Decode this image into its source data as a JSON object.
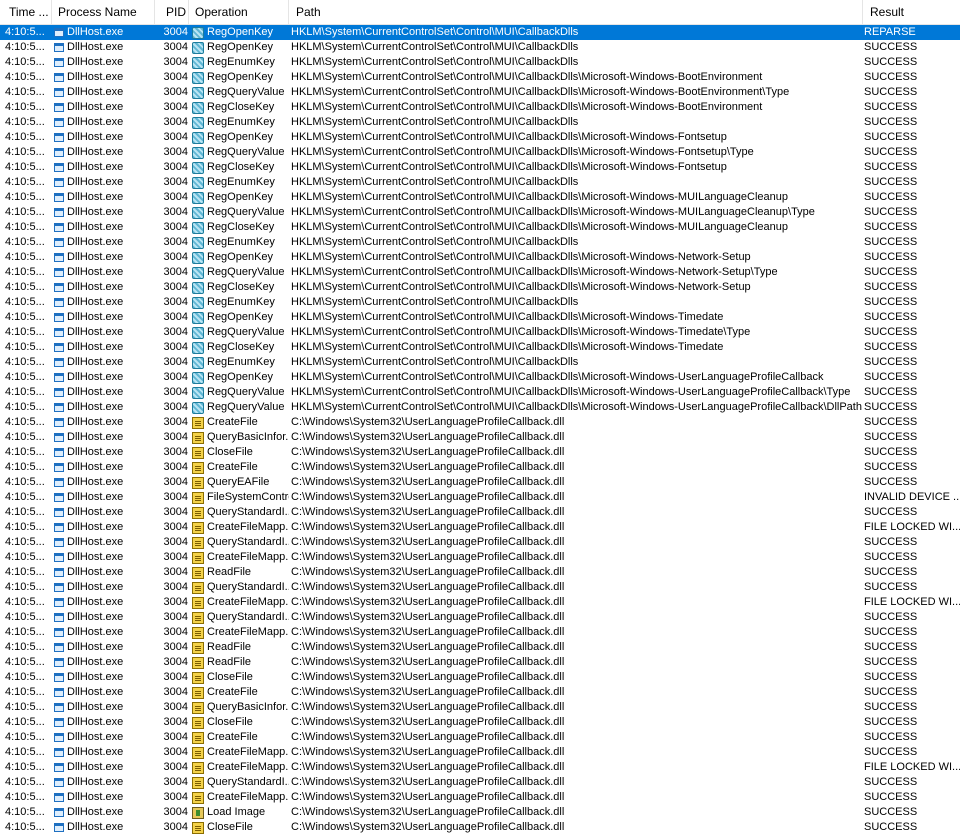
{
  "columns": {
    "time": "Time ...",
    "process": "Process Name",
    "pid": "PID",
    "operation": "Operation",
    "path": "Path",
    "result": "Result"
  },
  "rows": [
    {
      "time": "4:10:5...",
      "process": "DllHost.exe",
      "pid": "3004",
      "operation": "RegOpenKey",
      "icon": "registry-icon",
      "path": "HKLM\\System\\CurrentControlSet\\Control\\MUI\\CallbackDlls",
      "result": "REPARSE",
      "selected": true
    },
    {
      "time": "4:10:5...",
      "process": "DllHost.exe",
      "pid": "3004",
      "operation": "RegOpenKey",
      "icon": "registry-icon",
      "path": "HKLM\\System\\CurrentControlSet\\Control\\MUI\\CallbackDlls",
      "result": "SUCCESS"
    },
    {
      "time": "4:10:5...",
      "process": "DllHost.exe",
      "pid": "3004",
      "operation": "RegEnumKey",
      "icon": "registry-icon",
      "path": "HKLM\\System\\CurrentControlSet\\Control\\MUI\\CallbackDlls",
      "result": "SUCCESS"
    },
    {
      "time": "4:10:5...",
      "process": "DllHost.exe",
      "pid": "3004",
      "operation": "RegOpenKey",
      "icon": "registry-icon",
      "path": "HKLM\\System\\CurrentControlSet\\Control\\MUI\\CallbackDlls\\Microsoft-Windows-BootEnvironment",
      "result": "SUCCESS"
    },
    {
      "time": "4:10:5...",
      "process": "DllHost.exe",
      "pid": "3004",
      "operation": "RegQueryValue",
      "icon": "registry-icon",
      "path": "HKLM\\System\\CurrentControlSet\\Control\\MUI\\CallbackDlls\\Microsoft-Windows-BootEnvironment\\Type",
      "result": "SUCCESS"
    },
    {
      "time": "4:10:5...",
      "process": "DllHost.exe",
      "pid": "3004",
      "operation": "RegCloseKey",
      "icon": "registry-icon",
      "path": "HKLM\\System\\CurrentControlSet\\Control\\MUI\\CallbackDlls\\Microsoft-Windows-BootEnvironment",
      "result": "SUCCESS"
    },
    {
      "time": "4:10:5...",
      "process": "DllHost.exe",
      "pid": "3004",
      "operation": "RegEnumKey",
      "icon": "registry-icon",
      "path": "HKLM\\System\\CurrentControlSet\\Control\\MUI\\CallbackDlls",
      "result": "SUCCESS"
    },
    {
      "time": "4:10:5...",
      "process": "DllHost.exe",
      "pid": "3004",
      "operation": "RegOpenKey",
      "icon": "registry-icon",
      "path": "HKLM\\System\\CurrentControlSet\\Control\\MUI\\CallbackDlls\\Microsoft-Windows-Fontsetup",
      "result": "SUCCESS"
    },
    {
      "time": "4:10:5...",
      "process": "DllHost.exe",
      "pid": "3004",
      "operation": "RegQueryValue",
      "icon": "registry-icon",
      "path": "HKLM\\System\\CurrentControlSet\\Control\\MUI\\CallbackDlls\\Microsoft-Windows-Fontsetup\\Type",
      "result": "SUCCESS"
    },
    {
      "time": "4:10:5...",
      "process": "DllHost.exe",
      "pid": "3004",
      "operation": "RegCloseKey",
      "icon": "registry-icon",
      "path": "HKLM\\System\\CurrentControlSet\\Control\\MUI\\CallbackDlls\\Microsoft-Windows-Fontsetup",
      "result": "SUCCESS"
    },
    {
      "time": "4:10:5...",
      "process": "DllHost.exe",
      "pid": "3004",
      "operation": "RegEnumKey",
      "icon": "registry-icon",
      "path": "HKLM\\System\\CurrentControlSet\\Control\\MUI\\CallbackDlls",
      "result": "SUCCESS"
    },
    {
      "time": "4:10:5...",
      "process": "DllHost.exe",
      "pid": "3004",
      "operation": "RegOpenKey",
      "icon": "registry-icon",
      "path": "HKLM\\System\\CurrentControlSet\\Control\\MUI\\CallbackDlls\\Microsoft-Windows-MUILanguageCleanup",
      "result": "SUCCESS"
    },
    {
      "time": "4:10:5...",
      "process": "DllHost.exe",
      "pid": "3004",
      "operation": "RegQueryValue",
      "icon": "registry-icon",
      "path": "HKLM\\System\\CurrentControlSet\\Control\\MUI\\CallbackDlls\\Microsoft-Windows-MUILanguageCleanup\\Type",
      "result": "SUCCESS"
    },
    {
      "time": "4:10:5...",
      "process": "DllHost.exe",
      "pid": "3004",
      "operation": "RegCloseKey",
      "icon": "registry-icon",
      "path": "HKLM\\System\\CurrentControlSet\\Control\\MUI\\CallbackDlls\\Microsoft-Windows-MUILanguageCleanup",
      "result": "SUCCESS"
    },
    {
      "time": "4:10:5...",
      "process": "DllHost.exe",
      "pid": "3004",
      "operation": "RegEnumKey",
      "icon": "registry-icon",
      "path": "HKLM\\System\\CurrentControlSet\\Control\\MUI\\CallbackDlls",
      "result": "SUCCESS"
    },
    {
      "time": "4:10:5...",
      "process": "DllHost.exe",
      "pid": "3004",
      "operation": "RegOpenKey",
      "icon": "registry-icon",
      "path": "HKLM\\System\\CurrentControlSet\\Control\\MUI\\CallbackDlls\\Microsoft-Windows-Network-Setup",
      "result": "SUCCESS"
    },
    {
      "time": "4:10:5...",
      "process": "DllHost.exe",
      "pid": "3004",
      "operation": "RegQueryValue",
      "icon": "registry-icon",
      "path": "HKLM\\System\\CurrentControlSet\\Control\\MUI\\CallbackDlls\\Microsoft-Windows-Network-Setup\\Type",
      "result": "SUCCESS"
    },
    {
      "time": "4:10:5...",
      "process": "DllHost.exe",
      "pid": "3004",
      "operation": "RegCloseKey",
      "icon": "registry-icon",
      "path": "HKLM\\System\\CurrentControlSet\\Control\\MUI\\CallbackDlls\\Microsoft-Windows-Network-Setup",
      "result": "SUCCESS"
    },
    {
      "time": "4:10:5...",
      "process": "DllHost.exe",
      "pid": "3004",
      "operation": "RegEnumKey",
      "icon": "registry-icon",
      "path": "HKLM\\System\\CurrentControlSet\\Control\\MUI\\CallbackDlls",
      "result": "SUCCESS"
    },
    {
      "time": "4:10:5...",
      "process": "DllHost.exe",
      "pid": "3004",
      "operation": "RegOpenKey",
      "icon": "registry-icon",
      "path": "HKLM\\System\\CurrentControlSet\\Control\\MUI\\CallbackDlls\\Microsoft-Windows-Timedate",
      "result": "SUCCESS"
    },
    {
      "time": "4:10:5...",
      "process": "DllHost.exe",
      "pid": "3004",
      "operation": "RegQueryValue",
      "icon": "registry-icon",
      "path": "HKLM\\System\\CurrentControlSet\\Control\\MUI\\CallbackDlls\\Microsoft-Windows-Timedate\\Type",
      "result": "SUCCESS"
    },
    {
      "time": "4:10:5...",
      "process": "DllHost.exe",
      "pid": "3004",
      "operation": "RegCloseKey",
      "icon": "registry-icon",
      "path": "HKLM\\System\\CurrentControlSet\\Control\\MUI\\CallbackDlls\\Microsoft-Windows-Timedate",
      "result": "SUCCESS"
    },
    {
      "time": "4:10:5...",
      "process": "DllHost.exe",
      "pid": "3004",
      "operation": "RegEnumKey",
      "icon": "registry-icon",
      "path": "HKLM\\System\\CurrentControlSet\\Control\\MUI\\CallbackDlls",
      "result": "SUCCESS"
    },
    {
      "time": "4:10:5...",
      "process": "DllHost.exe",
      "pid": "3004",
      "operation": "RegOpenKey",
      "icon": "registry-icon",
      "path": "HKLM\\System\\CurrentControlSet\\Control\\MUI\\CallbackDlls\\Microsoft-Windows-UserLanguageProfileCallback",
      "result": "SUCCESS"
    },
    {
      "time": "4:10:5...",
      "process": "DllHost.exe",
      "pid": "3004",
      "operation": "RegQueryValue",
      "icon": "registry-icon",
      "path": "HKLM\\System\\CurrentControlSet\\Control\\MUI\\CallbackDlls\\Microsoft-Windows-UserLanguageProfileCallback\\Type",
      "result": "SUCCESS"
    },
    {
      "time": "4:10:5...",
      "process": "DllHost.exe",
      "pid": "3004",
      "operation": "RegQueryValue",
      "icon": "registry-icon",
      "path": "HKLM\\System\\CurrentControlSet\\Control\\MUI\\CallbackDlls\\Microsoft-Windows-UserLanguageProfileCallback\\DllPath",
      "result": "SUCCESS"
    },
    {
      "time": "4:10:5...",
      "process": "DllHost.exe",
      "pid": "3004",
      "operation": "CreateFile",
      "icon": "file-icon",
      "path": "C:\\Windows\\System32\\UserLanguageProfileCallback.dll",
      "result": "SUCCESS"
    },
    {
      "time": "4:10:5...",
      "process": "DllHost.exe",
      "pid": "3004",
      "operation": "QueryBasicInfor...",
      "icon": "file-icon",
      "path": "C:\\Windows\\System32\\UserLanguageProfileCallback.dll",
      "result": "SUCCESS"
    },
    {
      "time": "4:10:5...",
      "process": "DllHost.exe",
      "pid": "3004",
      "operation": "CloseFile",
      "icon": "file-icon",
      "path": "C:\\Windows\\System32\\UserLanguageProfileCallback.dll",
      "result": "SUCCESS"
    },
    {
      "time": "4:10:5...",
      "process": "DllHost.exe",
      "pid": "3004",
      "operation": "CreateFile",
      "icon": "file-icon",
      "path": "C:\\Windows\\System32\\UserLanguageProfileCallback.dll",
      "result": "SUCCESS"
    },
    {
      "time": "4:10:5...",
      "process": "DllHost.exe",
      "pid": "3004",
      "operation": "QueryEAFile",
      "icon": "file-icon",
      "path": "C:\\Windows\\System32\\UserLanguageProfileCallback.dll",
      "result": "SUCCESS"
    },
    {
      "time": "4:10:5...",
      "process": "DllHost.exe",
      "pid": "3004",
      "operation": "FileSystemControl",
      "icon": "file-icon",
      "path": "C:\\Windows\\System32\\UserLanguageProfileCallback.dll",
      "result": "INVALID DEVICE ..."
    },
    {
      "time": "4:10:5...",
      "process": "DllHost.exe",
      "pid": "3004",
      "operation": "QueryStandardI...",
      "icon": "file-icon",
      "path": "C:\\Windows\\System32\\UserLanguageProfileCallback.dll",
      "result": "SUCCESS"
    },
    {
      "time": "4:10:5...",
      "process": "DllHost.exe",
      "pid": "3004",
      "operation": "CreateFileMapp...",
      "icon": "file-icon",
      "path": "C:\\Windows\\System32\\UserLanguageProfileCallback.dll",
      "result": "FILE LOCKED WI..."
    },
    {
      "time": "4:10:5...",
      "process": "DllHost.exe",
      "pid": "3004",
      "operation": "QueryStandardI...",
      "icon": "file-icon",
      "path": "C:\\Windows\\System32\\UserLanguageProfileCallback.dll",
      "result": "SUCCESS"
    },
    {
      "time": "4:10:5...",
      "process": "DllHost.exe",
      "pid": "3004",
      "operation": "CreateFileMapp...",
      "icon": "file-icon",
      "path": "C:\\Windows\\System32\\UserLanguageProfileCallback.dll",
      "result": "SUCCESS"
    },
    {
      "time": "4:10:5...",
      "process": "DllHost.exe",
      "pid": "3004",
      "operation": "ReadFile",
      "icon": "file-icon",
      "path": "C:\\Windows\\System32\\UserLanguageProfileCallback.dll",
      "result": "SUCCESS"
    },
    {
      "time": "4:10:5...",
      "process": "DllHost.exe",
      "pid": "3004",
      "operation": "QueryStandardI...",
      "icon": "file-icon",
      "path": "C:\\Windows\\System32\\UserLanguageProfileCallback.dll",
      "result": "SUCCESS"
    },
    {
      "time": "4:10:5...",
      "process": "DllHost.exe",
      "pid": "3004",
      "operation": "CreateFileMapp...",
      "icon": "file-icon",
      "path": "C:\\Windows\\System32\\UserLanguageProfileCallback.dll",
      "result": "FILE LOCKED WI..."
    },
    {
      "time": "4:10:5...",
      "process": "DllHost.exe",
      "pid": "3004",
      "operation": "QueryStandardI...",
      "icon": "file-icon",
      "path": "C:\\Windows\\System32\\UserLanguageProfileCallback.dll",
      "result": "SUCCESS"
    },
    {
      "time": "4:10:5...",
      "process": "DllHost.exe",
      "pid": "3004",
      "operation": "CreateFileMapp...",
      "icon": "file-icon",
      "path": "C:\\Windows\\System32\\UserLanguageProfileCallback.dll",
      "result": "SUCCESS"
    },
    {
      "time": "4:10:5...",
      "process": "DllHost.exe",
      "pid": "3004",
      "operation": "ReadFile",
      "icon": "file-icon",
      "path": "C:\\Windows\\System32\\UserLanguageProfileCallback.dll",
      "result": "SUCCESS"
    },
    {
      "time": "4:10:5...",
      "process": "DllHost.exe",
      "pid": "3004",
      "operation": "ReadFile",
      "icon": "file-icon",
      "path": "C:\\Windows\\System32\\UserLanguageProfileCallback.dll",
      "result": "SUCCESS"
    },
    {
      "time": "4:10:5...",
      "process": "DllHost.exe",
      "pid": "3004",
      "operation": "CloseFile",
      "icon": "file-icon",
      "path": "C:\\Windows\\System32\\UserLanguageProfileCallback.dll",
      "result": "SUCCESS"
    },
    {
      "time": "4:10:5...",
      "process": "DllHost.exe",
      "pid": "3004",
      "operation": "CreateFile",
      "icon": "file-icon",
      "path": "C:\\Windows\\System32\\UserLanguageProfileCallback.dll",
      "result": "SUCCESS"
    },
    {
      "time": "4:10:5...",
      "process": "DllHost.exe",
      "pid": "3004",
      "operation": "QueryBasicInfor...",
      "icon": "file-icon",
      "path": "C:\\Windows\\System32\\UserLanguageProfileCallback.dll",
      "result": "SUCCESS"
    },
    {
      "time": "4:10:5...",
      "process": "DllHost.exe",
      "pid": "3004",
      "operation": "CloseFile",
      "icon": "file-icon",
      "path": "C:\\Windows\\System32\\UserLanguageProfileCallback.dll",
      "result": "SUCCESS"
    },
    {
      "time": "4:10:5...",
      "process": "DllHost.exe",
      "pid": "3004",
      "operation": "CreateFile",
      "icon": "file-icon",
      "path": "C:\\Windows\\System32\\UserLanguageProfileCallback.dll",
      "result": "SUCCESS"
    },
    {
      "time": "4:10:5...",
      "process": "DllHost.exe",
      "pid": "3004",
      "operation": "CreateFileMapp...",
      "icon": "file-icon",
      "path": "C:\\Windows\\System32\\UserLanguageProfileCallback.dll",
      "result": "SUCCESS"
    },
    {
      "time": "4:10:5...",
      "process": "DllHost.exe",
      "pid": "3004",
      "operation": "CreateFileMapp...",
      "icon": "file-icon",
      "path": "C:\\Windows\\System32\\UserLanguageProfileCallback.dll",
      "result": "FILE LOCKED WI..."
    },
    {
      "time": "4:10:5...",
      "process": "DllHost.exe",
      "pid": "3004",
      "operation": "QueryStandardI...",
      "icon": "file-icon",
      "path": "C:\\Windows\\System32\\UserLanguageProfileCallback.dll",
      "result": "SUCCESS"
    },
    {
      "time": "4:10:5...",
      "process": "DllHost.exe",
      "pid": "3004",
      "operation": "CreateFileMapp...",
      "icon": "file-icon",
      "path": "C:\\Windows\\System32\\UserLanguageProfileCallback.dll",
      "result": "SUCCESS"
    },
    {
      "time": "4:10:5...",
      "process": "DllHost.exe",
      "pid": "3004",
      "operation": "Load Image",
      "icon": "load-image-icon",
      "path": "C:\\Windows\\System32\\UserLanguageProfileCallback.dll",
      "result": "SUCCESS"
    },
    {
      "time": "4:10:5...",
      "process": "DllHost.exe",
      "pid": "3004",
      "operation": "CloseFile",
      "icon": "file-icon",
      "path": "C:\\Windows\\System32\\UserLanguageProfileCallback.dll",
      "result": "SUCCESS"
    }
  ]
}
